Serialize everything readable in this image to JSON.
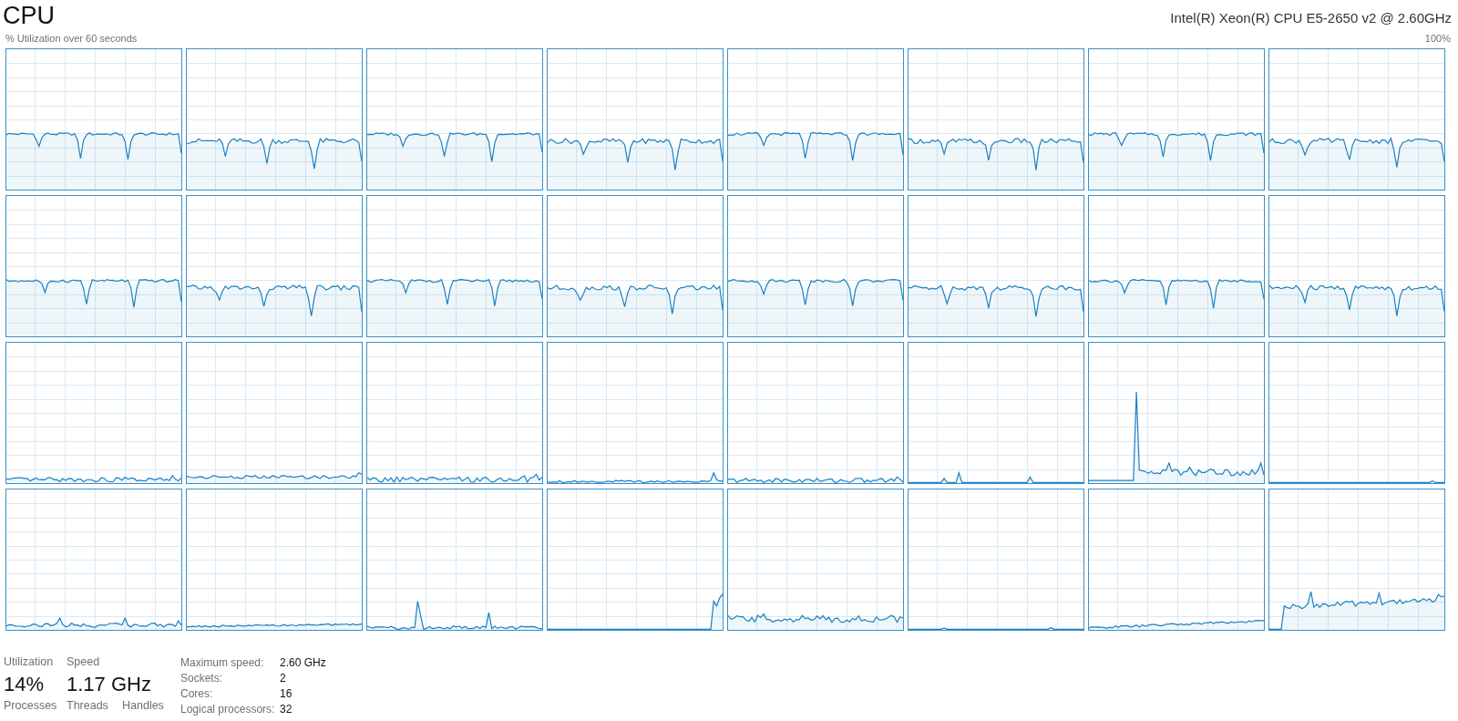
{
  "header": {
    "title": "CPU",
    "processor_name": "Intel(R) Xeon(R) CPU E5-2650 v2 @ 2.60GHz"
  },
  "graph": {
    "caption": "% Utilization over 60 seconds",
    "max_label": "100%"
  },
  "stats": [
    {
      "label": "Utilization",
      "value": "14%"
    },
    {
      "label": "Speed",
      "value": "1.17 GHz"
    }
  ],
  "counters": [
    "Processes",
    "Threads",
    "Handles"
  ],
  "details": [
    {
      "label": "Maximum speed:",
      "value": "2.60 GHz"
    },
    {
      "label": "Sockets:",
      "value": "2"
    },
    {
      "label": "Cores:",
      "value": "16"
    },
    {
      "label": "Logical processors:",
      "value": "32"
    }
  ]
}
